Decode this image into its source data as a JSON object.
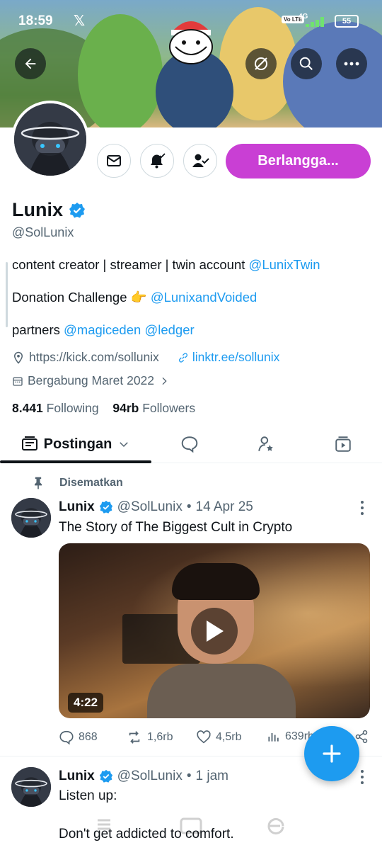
{
  "status_bar": {
    "time": "18:59",
    "volte": "Vo LTE",
    "network": "4G",
    "battery": "55"
  },
  "profile": {
    "name": "Lunix",
    "handle": "@SolLunix",
    "subscribe_label": "Berlangga...",
    "bio": {
      "line1_text": "content creator | streamer | twin account ",
      "line1_link": "@LunixTwin",
      "line2_text": "Donation Challenge 👉 ",
      "line2_link": "@LunixandVoided",
      "line3_text": "partners ",
      "line3_link1": "@magiceden",
      "line3_link2": "@ledger"
    },
    "website": "https://kick.com/sollunix",
    "linktree": "linktr.ee/sollunix",
    "joined": "Bergabung Maret 2022",
    "following_count": "8.441",
    "following_label": "Following",
    "followers_count": "94rb",
    "followers_label": "Followers"
  },
  "tabs": {
    "active_label": "Postingan",
    "icons": [
      "chat-bubble-icon",
      "person-star-icon",
      "video-play-icon"
    ]
  },
  "pinned_label": "Disematkan",
  "posts": [
    {
      "name": "Lunix",
      "handle": "@SolLunix",
      "sep": "•",
      "date": "14 Apr 25",
      "text": "The Story of The Biggest Cult in Crypto",
      "video_duration": "4:22",
      "replies": "868",
      "reposts": "1,6rb",
      "likes": "4,5rb",
      "views": "639rb"
    },
    {
      "name": "Lunix",
      "handle": "@SolLunix",
      "sep": "•",
      "date": "1 jam",
      "text_line1": "Listen up:",
      "text_line2": "Don't get addicted to comfort."
    }
  ],
  "colors": {
    "accent_blue": "#1d9bf0",
    "subscribe_purple": "#c93fd4",
    "text_primary": "#0f1419",
    "text_secondary": "#536471"
  }
}
